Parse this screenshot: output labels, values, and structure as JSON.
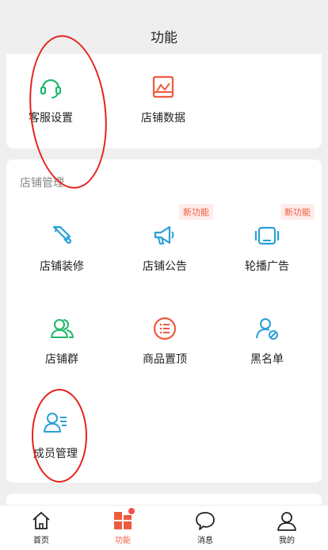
{
  "header": {
    "title": "功能"
  },
  "top_card": {
    "items": [
      {
        "label": "客服设置",
        "icon": "headset-icon"
      },
      {
        "label": "店铺数据",
        "icon": "chart-icon"
      }
    ]
  },
  "management": {
    "title": "店铺管理",
    "items": [
      {
        "label": "店铺装修",
        "icon": "brush-icon"
      },
      {
        "label": "店铺公告",
        "icon": "megaphone-icon",
        "badge": "新功能"
      },
      {
        "label": "轮播广告",
        "icon": "carousel-icon",
        "badge": "新功能"
      },
      {
        "label": "店铺群",
        "icon": "users-group-icon"
      },
      {
        "label": "商品置顶",
        "icon": "list-icon"
      },
      {
        "label": "黑名单",
        "icon": "user-block-icon"
      },
      {
        "label": "成员管理",
        "icon": "user-list-icon"
      }
    ]
  },
  "tabbar": {
    "tabs": [
      {
        "label": "首页",
        "icon": "home-icon"
      },
      {
        "label": "功能",
        "icon": "grid-icon",
        "active": true
      },
      {
        "label": "消息",
        "icon": "chat-icon"
      },
      {
        "label": "我的",
        "icon": "user-icon"
      }
    ]
  },
  "colors": {
    "accent": "#ef5b3f",
    "green": "#1fb86a",
    "blue": "#2a9fd8",
    "annotation": "#e5211b",
    "background": "#efefef"
  }
}
